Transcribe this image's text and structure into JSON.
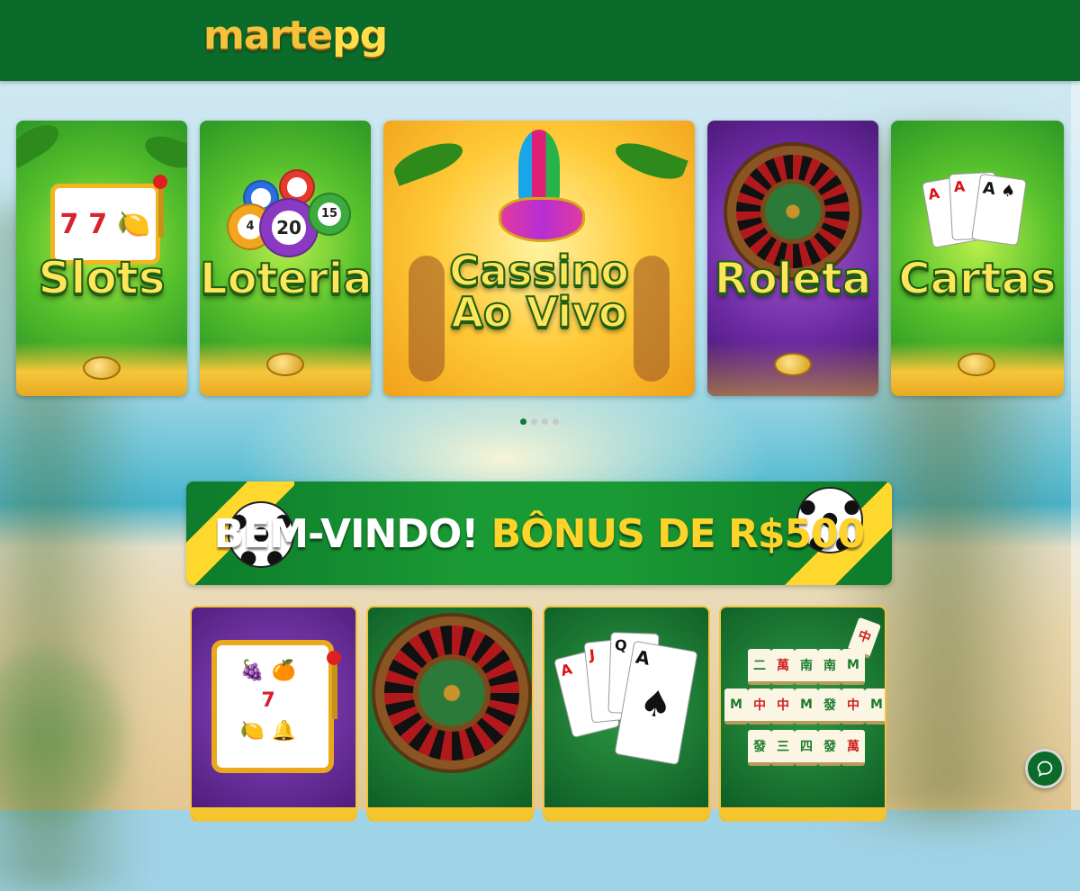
{
  "header": {
    "logo_part1": "marte",
    "logo_part2": "pg"
  },
  "carousel": {
    "slides": [
      {
        "title": "Slots"
      },
      {
        "title": "Loteria"
      },
      {
        "title_line1": "Cassino",
        "title_line2": "Ao Vivo"
      },
      {
        "title": "Roleta"
      },
      {
        "title": "Cartas"
      }
    ],
    "dots_count": 4,
    "active_dot": 1
  },
  "balls": [
    "4",
    "20",
    "15"
  ],
  "slot_reels": [
    "7",
    "7",
    "🍋"
  ],
  "banner": {
    "text_white": "BEM-VINDO!",
    "text_yellow": "BÔNUS DE R$500"
  },
  "cards": {
    "a1": "A",
    "a2": "A",
    "a3": "A",
    "spade": "♠",
    "q": "Q",
    "j": "J"
  },
  "mahjong_tiles": [
    "二",
    "萬",
    "南",
    "南",
    "M",
    "M",
    "中",
    "中",
    "M",
    "發",
    "中",
    "三",
    "四",
    "發",
    "萬"
  ],
  "colors": {
    "header_green": "#0b6b2b",
    "gold": "#f4c33b",
    "banner_yellow": "#ffd42a"
  },
  "icons": {
    "chat": "chat-bubble-icon"
  }
}
